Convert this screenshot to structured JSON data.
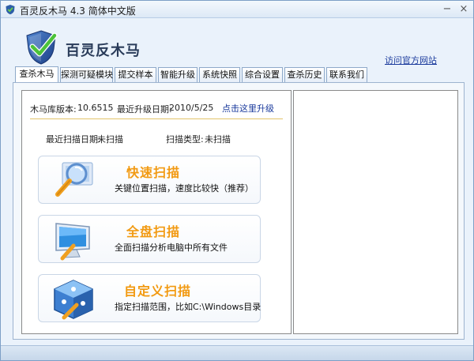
{
  "window": {
    "title": "百灵反木马 4.3 简体中文版",
    "minimize_glyph": "−",
    "close_glyph": "×"
  },
  "header": {
    "brand": "百灵反木马",
    "official_link": "访问官方网站",
    "logo_icon": "shield-check-icon"
  },
  "tabs": [
    {
      "label": "查杀木马",
      "active": true
    },
    {
      "label": "探测可疑模块",
      "active": false
    },
    {
      "label": "提交样本",
      "active": false
    },
    {
      "label": "智能升级",
      "active": false
    },
    {
      "label": "系统快照",
      "active": false
    },
    {
      "label": "综合设置",
      "active": false
    },
    {
      "label": "查杀历史",
      "active": false
    },
    {
      "label": "联系我们",
      "active": false
    }
  ],
  "info": {
    "db_version_label": "木马库版本:",
    "db_version": "10.6515",
    "last_update_label": "最近升级日期:",
    "last_update": "2010/5/25",
    "upgrade_link": "点击这里升级",
    "last_scan_label": "最近扫描日期:",
    "last_scan": "未扫描",
    "scan_type_label": "扫描类型:",
    "scan_type": "未扫描"
  },
  "scan_options": [
    {
      "title": "快速扫描",
      "desc": "关键位置扫描，速度比较快（推荐）",
      "icon": "magnifier-icon"
    },
    {
      "title": "全盘扫描",
      "desc": "全面扫描分析电脑中所有文件",
      "icon": "monitor-icon"
    },
    {
      "title": "自定义扫描",
      "desc": "指定扫描范围，比如C:\\Windows目录",
      "icon": "custom-cube-icon"
    }
  ],
  "colors": {
    "accent_orange": "#f29a12",
    "link_blue": "#1a3a9c",
    "brand_text": "#2a3c5a"
  }
}
